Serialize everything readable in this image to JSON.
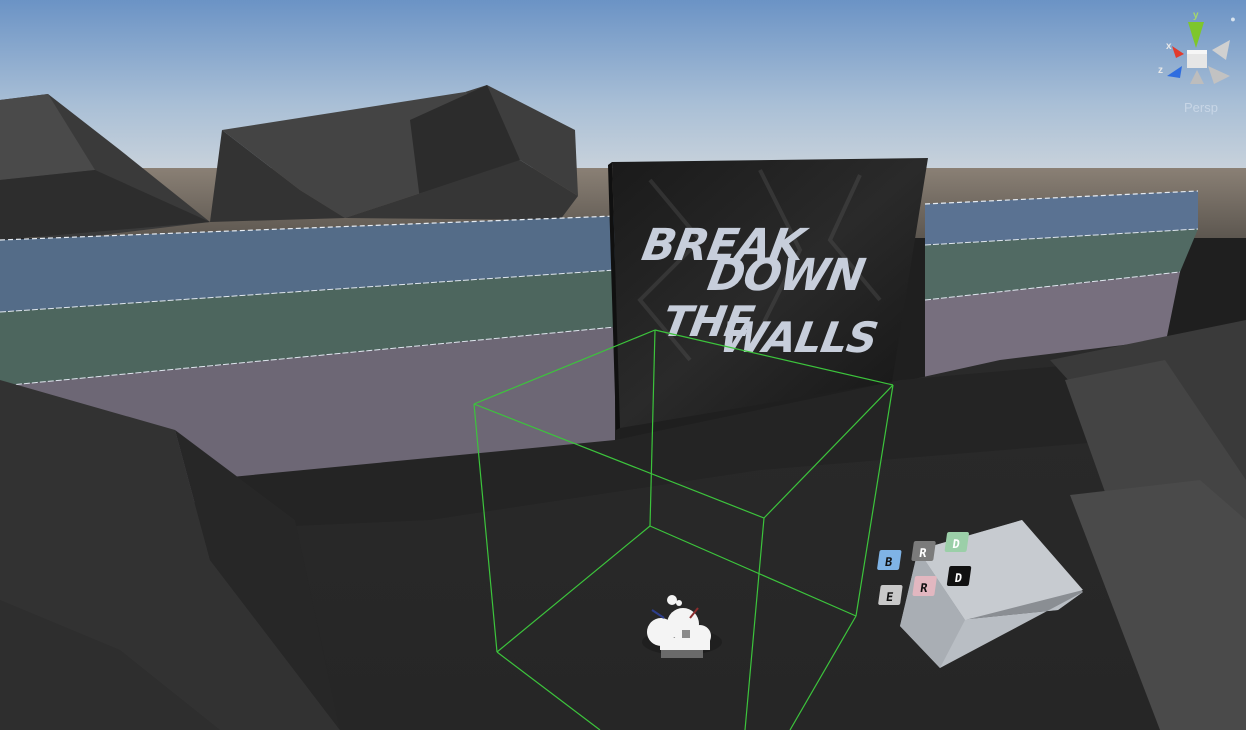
{
  "viewport": {
    "projection_label": "Persp",
    "gizmo_axes": {
      "y": "y",
      "x": "x",
      "z": "z"
    },
    "colors": {
      "sky_top": "#6a93c6",
      "sky_horizon": "#c9d3dc",
      "ground": "#2b2b2b",
      "wall_blue": "#536b88",
      "wall_green": "#4f675f",
      "wall_purple": "#6f6876",
      "trigger_box": "#39c839",
      "axis_x": "#e23b2c",
      "axis_y": "#7ec62b",
      "axis_z": "#2f6de0"
    }
  },
  "poster": {
    "lines": [
      "BREAK",
      "DOWN",
      "THE",
      "WALLS"
    ]
  },
  "keypad": {
    "keys": [
      {
        "label": "B",
        "color": "#7fb3e6"
      },
      {
        "label": "R",
        "color": "#7b7b7b"
      },
      {
        "label": "D",
        "color": "#9bcfa8"
      },
      {
        "label": "E",
        "color": "#c9c9c9"
      },
      {
        "label": "R",
        "color": "#e2b7c0"
      },
      {
        "label": "D",
        "color": "#111111"
      }
    ]
  },
  "icons": {
    "audio_source": "audio-source-icon",
    "trigger_bounds": "box-collider-gizmo",
    "orientation": "scene-orientation-gizmo"
  }
}
